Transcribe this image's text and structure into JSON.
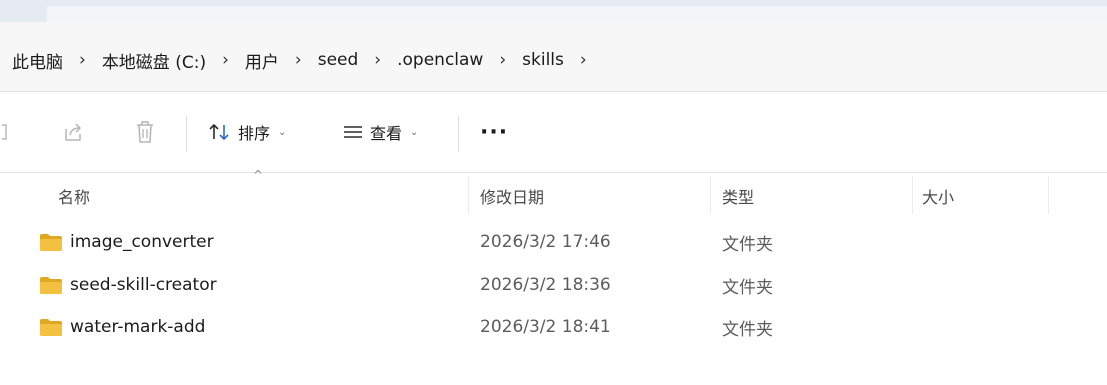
{
  "breadcrumb": [
    "此电脑",
    "本地磁盘 (C:)",
    "用户",
    "seed",
    ".openclaw",
    "skills"
  ],
  "toolbar": {
    "sort_label": "排序",
    "view_label": "查看",
    "more_label": "···"
  },
  "columns": {
    "name": "名称",
    "date": "修改日期",
    "type": "类型",
    "size": "大小"
  },
  "files": [
    {
      "name": "image_converter",
      "date": "2026/3/2 17:46",
      "type": "文件夹",
      "size": ""
    },
    {
      "name": "seed-skill-creator",
      "date": "2026/3/2 18:36",
      "type": "文件夹",
      "size": ""
    },
    {
      "name": "water-mark-add",
      "date": "2026/3/2 18:41",
      "type": "文件夹",
      "size": ""
    }
  ],
  "colors": {
    "folder": "#f4c042",
    "folder_dark": "#e0a723",
    "address_bg": "#f7f7f7"
  }
}
